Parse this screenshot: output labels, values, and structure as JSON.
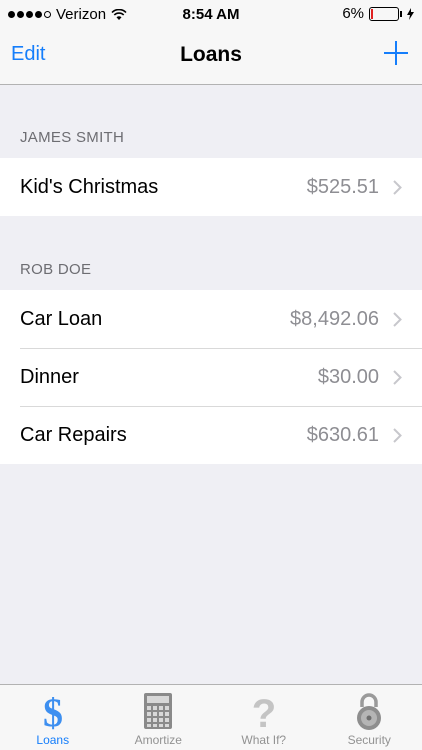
{
  "status": {
    "carrier": "Verizon",
    "time": "8:54 AM",
    "battery": "6%"
  },
  "nav": {
    "edit_label": "Edit",
    "title": "Loans"
  },
  "sections": [
    {
      "header": "JAMES SMITH",
      "rows": [
        {
          "title": "Kid's Christmas",
          "amount": "$525.51"
        }
      ]
    },
    {
      "header": "ROB DOE",
      "rows": [
        {
          "title": "Car Loan",
          "amount": "$8,492.06"
        },
        {
          "title": "Dinner",
          "amount": "$30.00"
        },
        {
          "title": "Car Repairs",
          "amount": "$630.61"
        }
      ]
    }
  ],
  "tabs": [
    {
      "label": "Loans",
      "icon": "dollar-icon",
      "active": true
    },
    {
      "label": "Amortize",
      "icon": "calculator-icon",
      "active": false
    },
    {
      "label": "What If?",
      "icon": "question-icon",
      "active": false
    },
    {
      "label": "Security",
      "icon": "padlock-icon",
      "active": false
    }
  ],
  "colors": {
    "accent": "#157efb",
    "secondary_text": "#8e8e93",
    "background": "#efeff4"
  }
}
